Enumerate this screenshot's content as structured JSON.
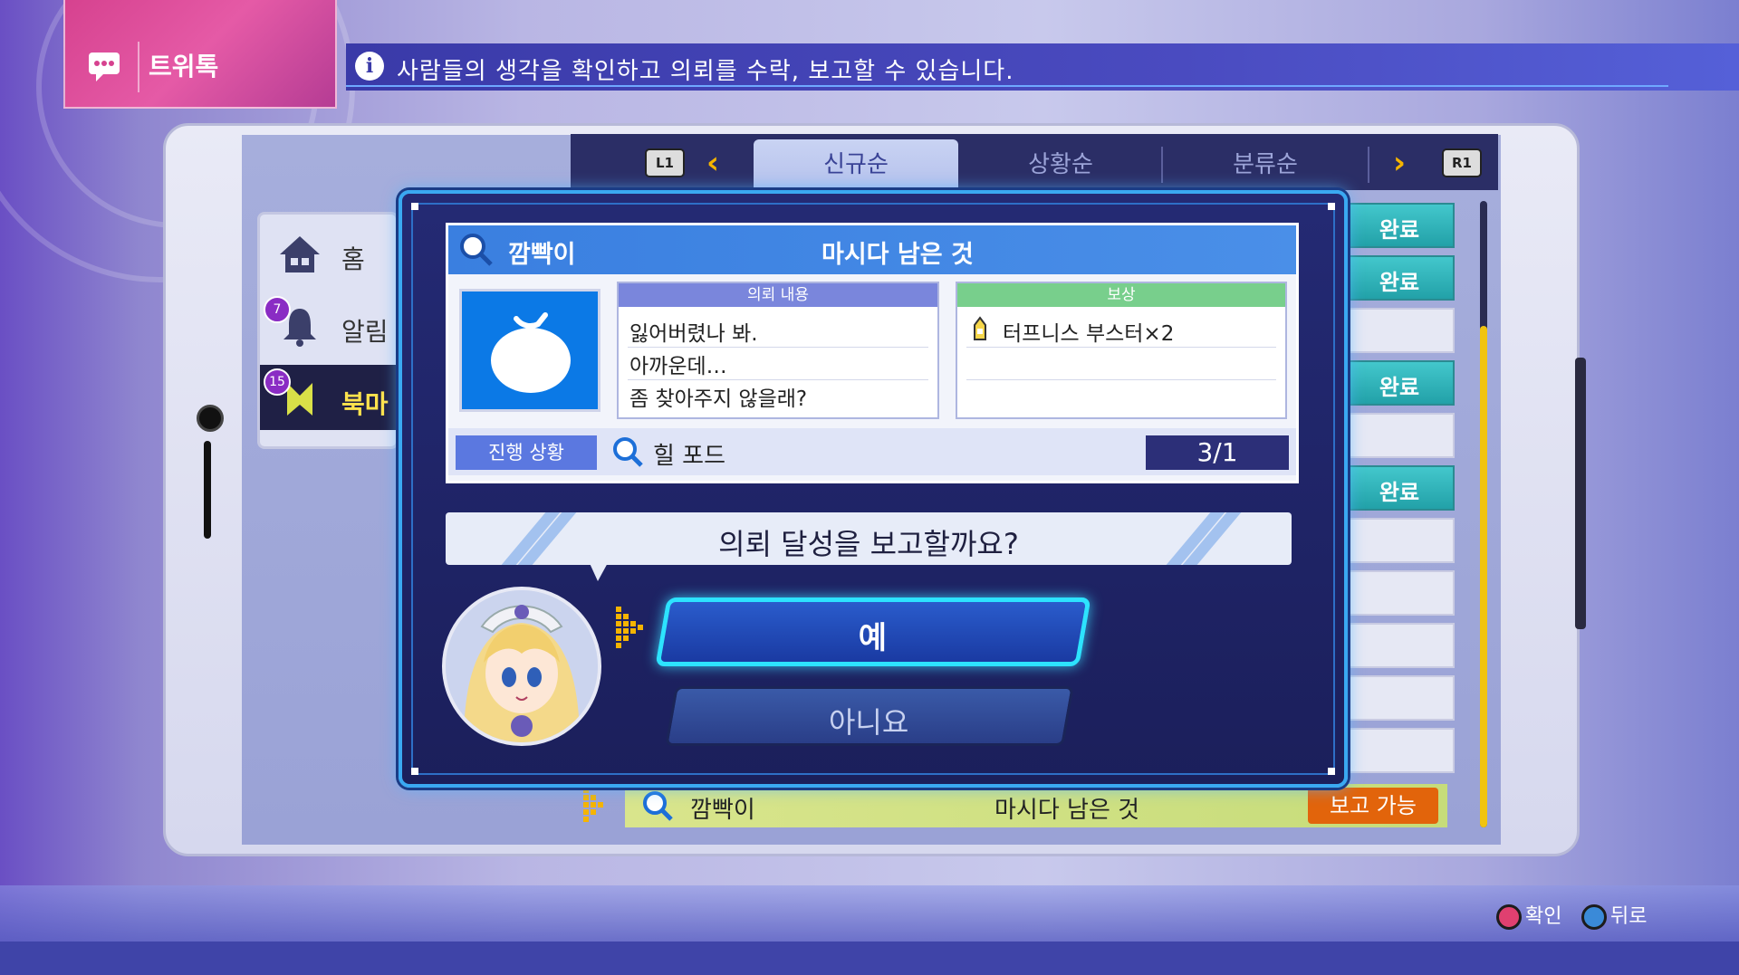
{
  "header": {
    "app_title": "트위톡",
    "info_text": "사람들의 생각을 확인하고 의뢰를 수락, 보고할 수 있습니다."
  },
  "sidebar": {
    "items": [
      {
        "label": "홈",
        "badge": ""
      },
      {
        "label": "알림",
        "badge": "7"
      },
      {
        "label": "북마",
        "badge": "15"
      }
    ]
  },
  "tabs": {
    "left_button": "L1",
    "right_button": "R1",
    "items": [
      "신규순",
      "상황순",
      "분류순"
    ],
    "active": "신규순"
  },
  "list": {
    "statuses": [
      "완료",
      "완료",
      "",
      "완료",
      "",
      "완료",
      "",
      "",
      "",
      "",
      ""
    ],
    "highlight": {
      "sender": "깜빡이",
      "title": "마시다 남은 것",
      "status": "보고 가능"
    }
  },
  "dialog": {
    "card": {
      "sender": "깜빡이",
      "title": "마시다 남은 것",
      "request_header": "의뢰 내용",
      "request_lines": [
        "잃어버렸나 봐.",
        "아까운데…",
        "좀 찾아주지 않을래?"
      ],
      "reward_header": "보상",
      "reward_lines": [
        "터프니스 부스터×2"
      ],
      "progress_label": "진행 상황",
      "progress_item": "힐 포드",
      "progress_count": "3/1"
    },
    "question": "의뢰 달성을 보고할까요?",
    "yes_label": "예",
    "no_label": "아니요"
  },
  "footer": {
    "confirm_label": "확인",
    "back_label": "뒤로"
  },
  "colors": {
    "accent_cyan": "#2de3ff",
    "done_badge": "#22a1a8",
    "report_badge": "#e2640b",
    "highlight_row": "#d9e58c",
    "tab_arrow": "#f5b400"
  }
}
